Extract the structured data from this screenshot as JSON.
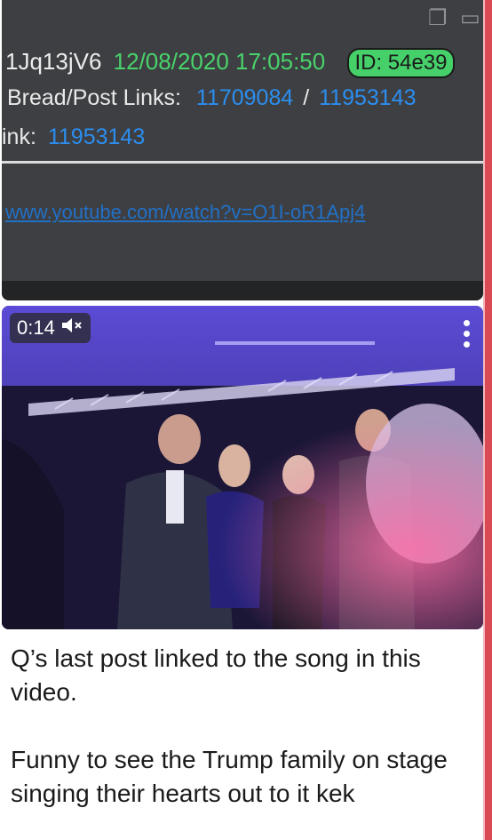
{
  "post_screenshot": {
    "username": "1Jq13jV6",
    "date": "12/08/2020 17:05:50",
    "id_badge": "ID: 54e39",
    "bread_label": "Bread/Post Links:",
    "bread_link_1": "11709084",
    "bread_sep": "/",
    "bread_link_2": "11953143",
    "link_label": "ink:",
    "link_value": "11953143",
    "youtube_url": "www.youtube.com/watch?v=O1I-oR1Apj4"
  },
  "video": {
    "time": "0:14",
    "mute_icon": "speaker-muted-icon",
    "menu_icon": "kebab-menu-icon"
  },
  "caption": {
    "line1": "Q’s last post linked to the song in this video.",
    "line2": "Funny to see the Trump family on stage singing their hearts out to it kek"
  },
  "colors": {
    "date_green": "#49d36b",
    "link_blue": "#2c8ef0",
    "accent_red": "#d94a55"
  }
}
